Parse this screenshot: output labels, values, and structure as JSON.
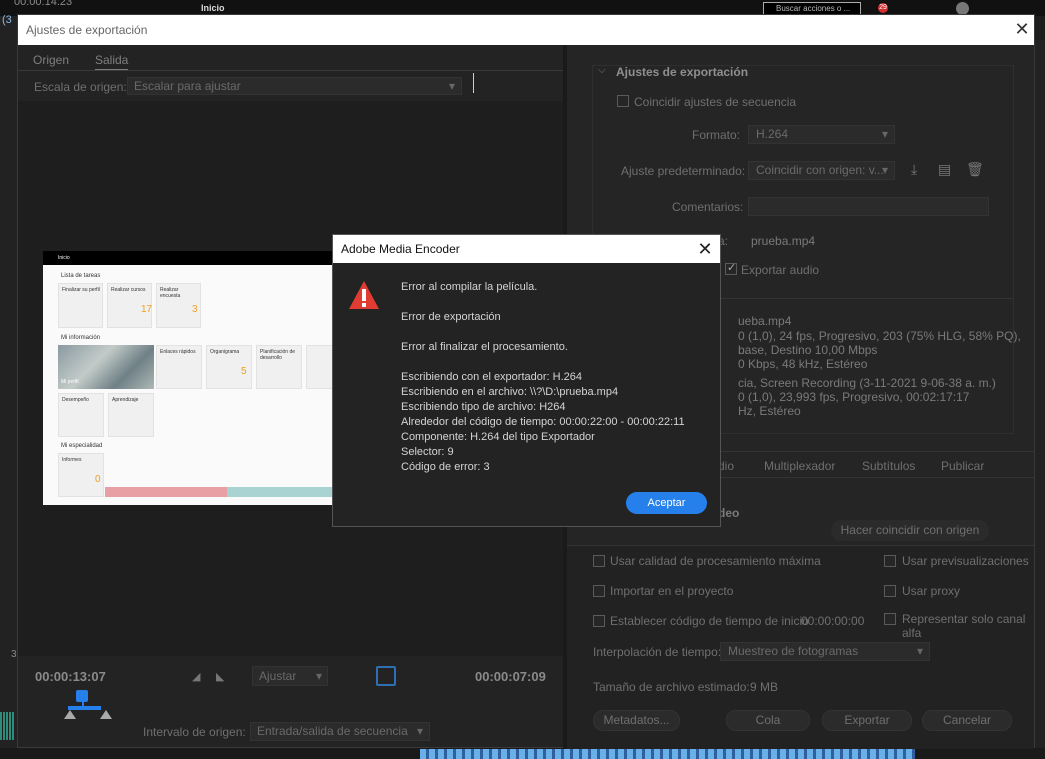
{
  "background": {
    "timecode": "00:00:14:23",
    "workspace": "Inicio",
    "search_placeholder": "Buscar acciones o ...",
    "notification_count": "29",
    "left_label": "(3",
    "panel_number": "3"
  },
  "export_window": {
    "title": "Ajustes de exportación",
    "tabs": [
      "Origen",
      "Salida"
    ],
    "source_scale_label": "Escala de origen:",
    "source_scale_value": "Escalar para ajustar",
    "timecode_in": "00:00:13:07",
    "timecode_out": "00:00:07:09",
    "fit_value": "Ajustar",
    "source_range_label": "Intervalo de origen:",
    "source_range_value": "Entrada/salida de secuencia"
  },
  "thumbnail": {
    "nav": "Inicio",
    "tasks_title": "Lista de tareas",
    "card1": "Finalizar su perfil",
    "card2": "Realizar cursos",
    "card3": "Realizar encuesta",
    "card2_value": "17",
    "card3_value": "3",
    "info_title": "Mi información",
    "map_caption": "Mi perfil",
    "quick_links": "Enlaces rápidos",
    "org_chart": "Organigrama",
    "dev_planning": "Planificación de desarrollo",
    "org_value": "5",
    "performance": "Desempeño",
    "learning": "Aprendizaje",
    "specialty_title": "Mi especialidad",
    "reports": "Informes",
    "reports_value": "0"
  },
  "export_settings": {
    "section_title": "Ajustes de exportación",
    "match_sequence_label": "Coincidir ajustes de secuencia",
    "format_label": "Formato:",
    "format_value": "H.264",
    "preset_label": "Ajuste predeterminado:",
    "preset_value": "Coincidir con origen: v...",
    "comments_label": "Comentarios:",
    "output_name_label_partial": "a:",
    "output_name": "prueba.mp4",
    "export_audio_label": "Exportar audio",
    "summary_lines": [
      "ueba.mp4",
      "0 (1,0), 24 fps, Progresivo, 203 (75% HLG, 58% PQ), ...",
      "base, Destino 10,00 Mbps",
      "0 Kbps, 48 kHz, Estéreo",
      "cia, Screen Recording (3-11-2021 9-06-38 a. m.)",
      "0 (1,0), 23,993 fps, Progresivo, 00:02:17:17",
      "Hz, Estéreo"
    ],
    "tabs": [
      "dio",
      "Multiplexador",
      "Subtítulos",
      "Publicar"
    ],
    "video_heading_partial": "deo",
    "match_source_button": "Hacer coincidir con origen",
    "max_render_quality": "Usar calidad de procesamiento máxima",
    "use_previews": "Usar previsualizaciones",
    "import_into_project": "Importar en el proyecto",
    "use_proxies": "Usar proxy",
    "set_start_timecode": "Establecer código de tiempo de inicio",
    "start_timecode_value": "00:00:00:00",
    "render_alpha_only": "Representar solo canal alfa",
    "time_interpolation_label": "Interpolación de tiempo:",
    "time_interpolation_value": "Muestreo de fotogramas",
    "estimated_size_label": "Tamaño de archivo estimado:",
    "estimated_size_value": "9 MB",
    "metadata_button": "Metadatos...",
    "queue_button": "Cola",
    "export_button": "Exportar",
    "cancel_button": "Cancelar"
  },
  "dialog": {
    "title": "Adobe Media Encoder",
    "line1": "Error al compilar la película.",
    "line2": "Error de exportación",
    "line3": "Error al finalizar el procesamiento.",
    "details": [
      "Escribiendo con el exportador: H.264",
      "Escribiendo en el archivo: \\\\?\\D:\\prueba.mp4",
      "Escribiendo tipo de archivo: H264",
      "Alrededor del código de tiempo: 00:00:22:00 - 00:00:22:11",
      "Componente: H.264 del tipo Exportador",
      "Selector: 9",
      "Código de error: 3"
    ],
    "accept_button": "Aceptar",
    "icon": "warning-icon"
  },
  "colors": {
    "accent": "#2680eb",
    "warning": "#e03c31"
  }
}
